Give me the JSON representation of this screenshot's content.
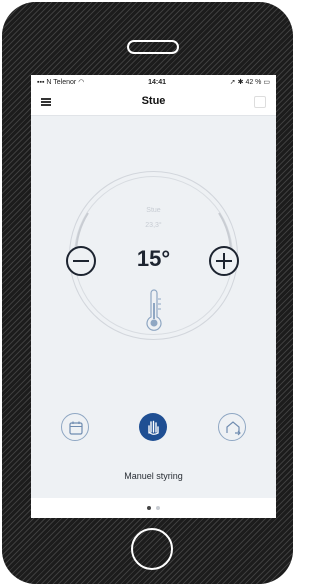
{
  "status_bar": {
    "carrier": "N Telenor",
    "time": "14:41",
    "battery": "42 %"
  },
  "nav": {
    "title": "Stue",
    "menu_icon": "hamburger-menu-icon"
  },
  "thermostat": {
    "room_name": "Stue",
    "current_temperature": "23,3°",
    "setpoint": "15°",
    "decrease_icon": "minus-icon",
    "increase_icon": "plus-icon",
    "thermometer_icon": "thermometer-icon"
  },
  "modes": {
    "items": [
      {
        "name": "schedule",
        "icon": "calendar-icon",
        "active": false
      },
      {
        "name": "manual",
        "icon": "hand-icon",
        "active": true
      },
      {
        "name": "away",
        "icon": "home-leave-icon",
        "active": false
      }
    ],
    "active_label": "Manuel styring"
  },
  "pager": {
    "pages": 2,
    "active": 1
  },
  "colors": {
    "accent": "#1f4f93",
    "dark": "#1d2430",
    "background": "#eef1f4"
  }
}
